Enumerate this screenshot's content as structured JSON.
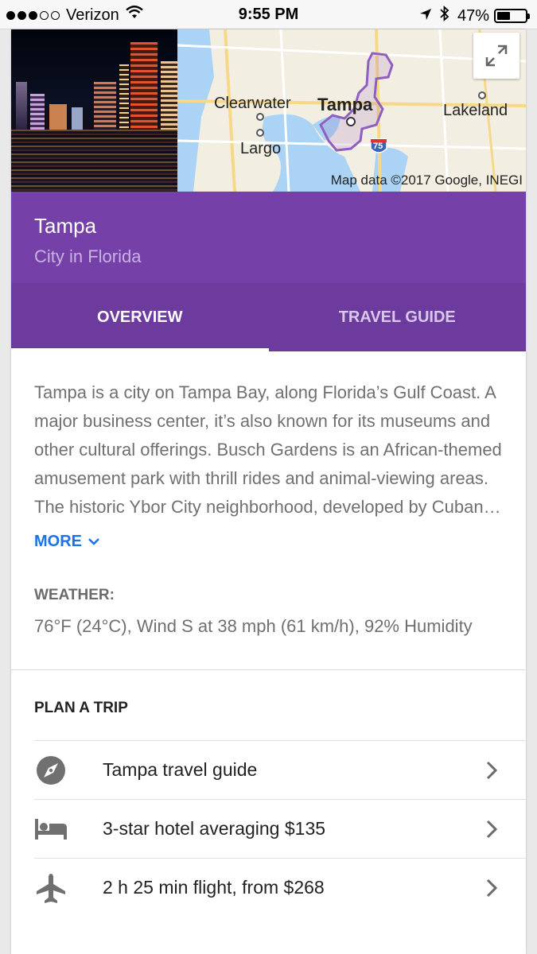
{
  "status_bar": {
    "carrier": "Verizon",
    "time": "9:55 PM",
    "battery": "47%",
    "battery_level": 0.47
  },
  "map": {
    "labels": {
      "clearwater": "Clearwater",
      "tampa": "Tampa",
      "lakeland": "Lakeland",
      "largo": "Largo",
      "interstate": "75"
    },
    "credit": "Map data ©2017 Google, INEGI"
  },
  "place": {
    "title": "Tampa",
    "subtitle": "City in Florida"
  },
  "tabs": [
    {
      "label": "OVERVIEW",
      "active": true
    },
    {
      "label": "TRAVEL GUIDE",
      "active": false
    }
  ],
  "overview": {
    "description": "Tampa is a city on Tampa Bay, along Florida’s Gulf Coast. A major business center, it’s also known for its museums and other cultural offerings. Busch Gardens is an African-themed amusement park with thrill rides and animal-viewing areas. The historic Ybor City neighborhood, developed by Cuban…",
    "more_label": "MORE"
  },
  "weather": {
    "label": "WEATHER:",
    "text": "76°F (24°C), Wind S at 38 mph (61 km/h), 92% Humidity"
  },
  "plan": {
    "label": "PLAN A TRIP",
    "items": [
      {
        "icon": "compass-icon",
        "label": "Tampa travel guide"
      },
      {
        "icon": "hotel-bed-icon",
        "label": "3-star hotel averaging $135"
      },
      {
        "icon": "airplane-icon",
        "label": "2 h 25 min flight, from $268"
      }
    ]
  },
  "colors": {
    "header": "#7540a8",
    "tabs": "#6d3a9e",
    "link": "#1a73e8"
  }
}
